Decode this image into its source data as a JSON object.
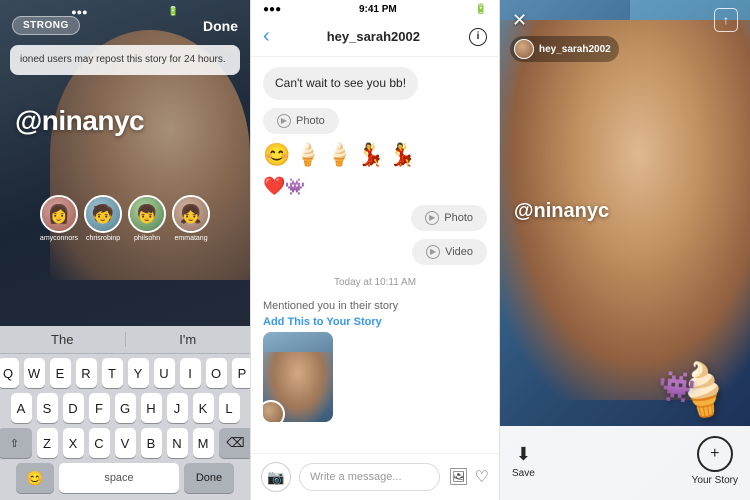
{
  "panel1": {
    "badge": "STRONG",
    "done_label": "Done",
    "banner_text": "ioned users may repost this story for 24 hours.",
    "mention": "@ninanyc",
    "avatars": [
      {
        "label": "amyconnors",
        "emoji": "👩",
        "bg": "#d4a0a0"
      },
      {
        "label": "chrisrobinp",
        "emoji": "🧒",
        "bg": "#a0c4d4"
      },
      {
        "label": "philsohn",
        "emoji": "👦",
        "bg": "#b0d4a0"
      },
      {
        "label": "emmatang",
        "emoji": "👧",
        "bg": "#d4b4a0"
      }
    ],
    "keyboard": {
      "autocomplete": [
        "The",
        "I'm"
      ],
      "rows": [
        [
          "Q",
          "W",
          "E",
          "R",
          "T",
          "Y",
          "U",
          "I",
          "O",
          "P"
        ],
        [
          "A",
          "S",
          "D",
          "F",
          "G",
          "H",
          "J",
          "K",
          "L"
        ],
        [
          "⇧",
          "Z",
          "X",
          "C",
          "V",
          "B",
          "N",
          "M",
          "⌫"
        ],
        [
          "space",
          "Done"
        ]
      ]
    }
  },
  "panel2": {
    "status_bar": {
      "time": "9:41 PM",
      "signal": "●●●○○",
      "wifi": "wifi",
      "battery": "battery"
    },
    "username": "hey_sarah2002",
    "back_label": "‹",
    "info_label": "i",
    "messages": [
      {
        "type": "received_text",
        "text": "Can't wait to see you bb!"
      },
      {
        "type": "received_media",
        "label": "Photo"
      },
      {
        "type": "emoji_row",
        "text": "😊 🍦 🍦 💃"
      },
      {
        "type": "heart",
        "text": "❤️"
      },
      {
        "type": "sent_media_photo",
        "label": "Photo"
      },
      {
        "type": "sent_media_video",
        "label": "Video"
      },
      {
        "type": "timestamp",
        "text": "Today at 10:11 AM"
      },
      {
        "type": "mention_notification",
        "text": "Mentioned you in their story",
        "link": "Add This to Your Story"
      }
    ],
    "input_placeholder": "Write a message...",
    "camera_icon": "📷",
    "gallery_icon": "🖼",
    "heart_icon": "♡"
  },
  "panel3": {
    "close_label": "✕",
    "share_icon": "↑",
    "username": "hey_sarah2002",
    "mention": "@ninanyc",
    "sticker_icecream": "🍦",
    "sticker_monster": "👾",
    "save_label": "Save",
    "save_icon": "⬇",
    "your_story_label": "Your Story",
    "story_icon": "+"
  }
}
